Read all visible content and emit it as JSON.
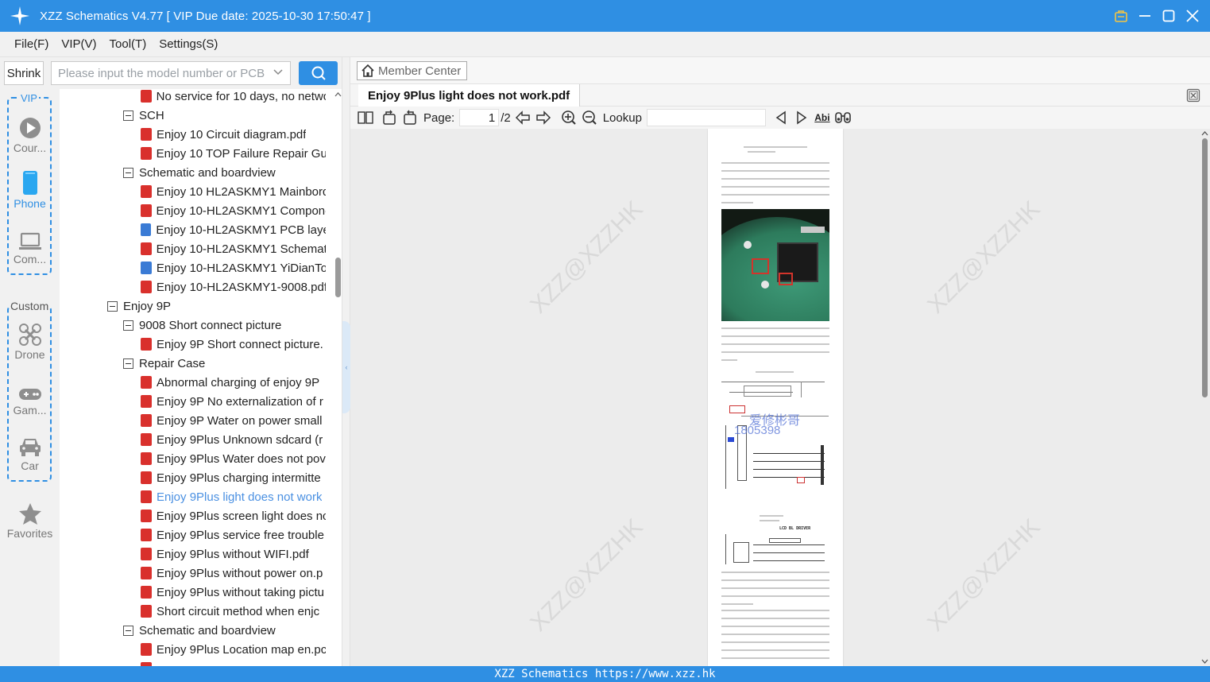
{
  "app": {
    "title": "XZZ Schematics V4.77 [ VIP Due date: 2025-10-30 17:50:47 ]"
  },
  "menu": [
    "File(F)",
    "VIP(V)",
    "Tool(T)",
    "Settings(S)"
  ],
  "search": {
    "shrink_label": "Shrink",
    "placeholder": "Please input the model number or PCB"
  },
  "rail": {
    "vip_label": "VIP",
    "custom_label": "Custom",
    "items": [
      "Cour...",
      "Phone",
      "Com...",
      "Drone",
      "Gam...",
      "Car",
      "Favorites"
    ]
  },
  "tree": [
    "No service for 10 days, no netwo",
    "SCH",
    "Enjoy 10 Circuit diagram.pdf",
    "Enjoy 10 TOP Failure Repair Gui",
    "Schematic and boardview",
    "Enjoy 10 HL2ASKMY1 Mainbord",
    "Enjoy 10-HL2ASKMY1 Compone",
    "Enjoy 10-HL2ASKMY1 PCB layer",
    "Enjoy 10-HL2ASKMY1 Schemati",
    "Enjoy 10-HL2ASKMY1 YiDianTo",
    "Enjoy 10-HL2ASKMY1-9008.pdf",
    "Enjoy 9P",
    "9008 Short connect picture",
    "Enjoy 9P Short connect picture.",
    "Repair Case",
    "Abnormal charging of enjoy 9P",
    "Enjoy 9P No externalization of r",
    "Enjoy 9P Water on power small",
    "Enjoy 9Plus Unknown sdcard (r",
    "Enjoy 9Plus Water does not pov",
    "Enjoy 9Plus charging intermitte",
    "Enjoy 9Plus light does not work",
    "Enjoy 9Plus screen light does nc",
    "Enjoy 9Plus service free trouble",
    "Enjoy 9Plus without WIFI.pdf",
    "Enjoy 9Plus without power on.p",
    "Enjoy 9Plus without taking pictu",
    "Short circuit method when enjc",
    "Schematic and boardview",
    "Enjoy 9Plus Location map en.pc"
  ],
  "right": {
    "member_center": "Member Center",
    "doc_tab": "Enjoy 9Plus light does not work.pdf",
    "page_label": "Page:",
    "page_current": "1",
    "page_total": "/2",
    "lookup_label": "Lookup",
    "find_label": "Abi"
  },
  "watermark": "XZZ@XZZHK",
  "pdf_overlay_text": [
    "爱修彬哥",
    "1805398"
  ],
  "pdf_lcd_label": "LCD BL DRIVER",
  "status": "XZZ Schematics https://www.xzz.hk",
  "colors": {
    "accent": "#2f8fe3",
    "pdf_icon": "#d9302c",
    "selected_text": "#4a90e2"
  }
}
